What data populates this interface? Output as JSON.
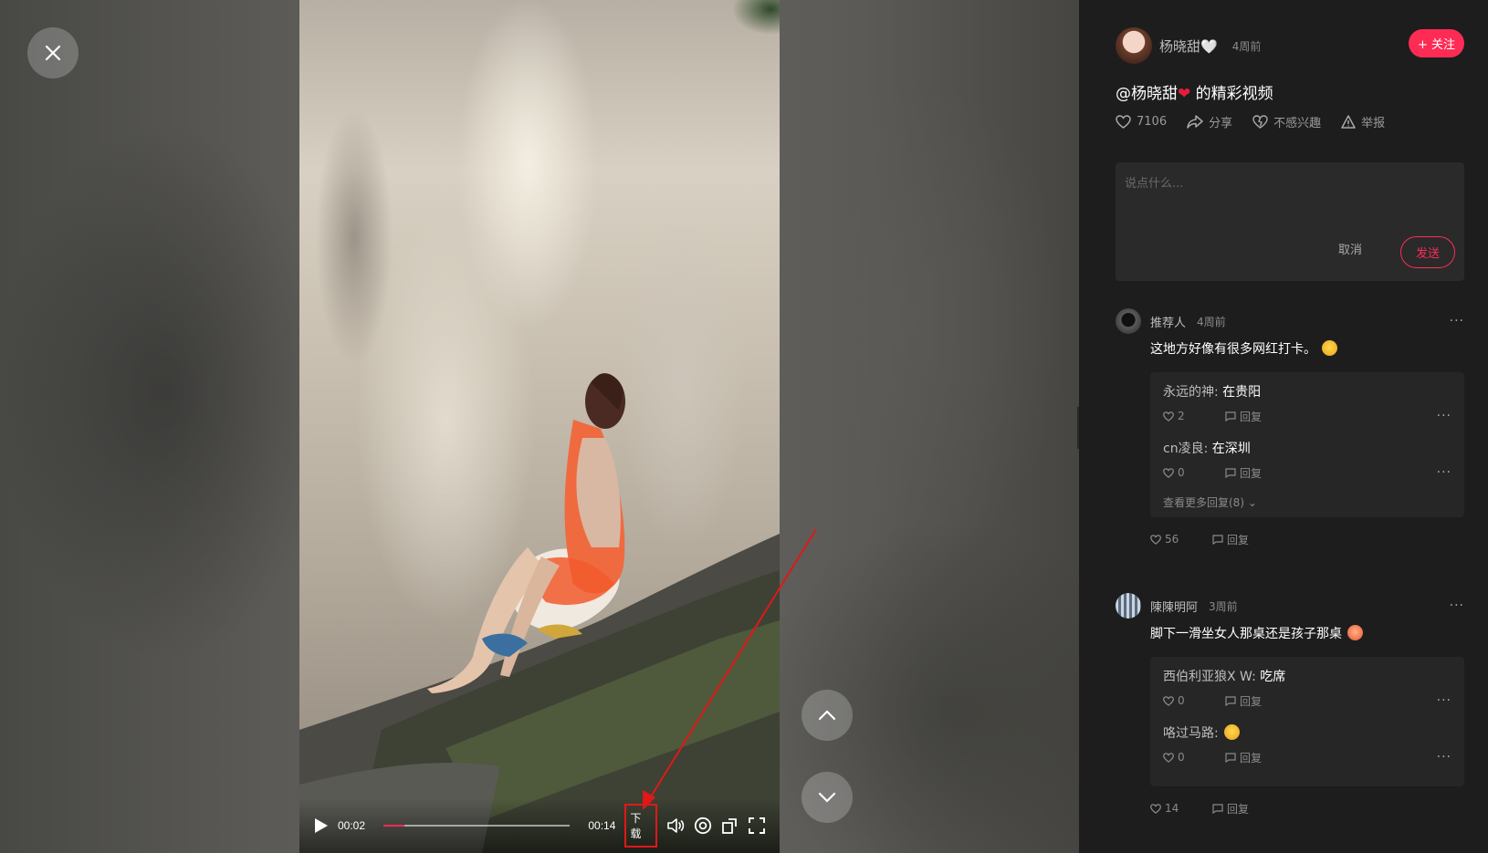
{
  "player": {
    "current_time": "00:02",
    "duration": "00:14",
    "progress": 0.11,
    "download_label": "下载"
  },
  "author": {
    "name": "杨晓甜🤍",
    "time": "4周前",
    "follow_label": "+ 关注"
  },
  "video": {
    "title_prefix": "@杨晓甜",
    "title_heart": "❤",
    "title_suffix": " 的精彩视频"
  },
  "actions": {
    "likes": "7106",
    "share": "分享",
    "not_interested": "不感兴趣",
    "report": "举报"
  },
  "comment_input": {
    "placeholder": "说点什么...",
    "cancel": "取消",
    "send": "发送"
  },
  "comments": [
    {
      "user": "推荐人",
      "time": "4周前",
      "text": "这地方好像有很多网红打卡。",
      "likes": "56",
      "reply_label": "回复",
      "replies": [
        {
          "user": "永远的神:",
          "text": "在贵阳",
          "likes": "2",
          "reply_label": "回复"
        },
        {
          "user": "cn凌良:",
          "text": "在深圳",
          "likes": "0",
          "reply_label": "回复"
        }
      ],
      "see_more": "查看更多回复(8) ⌄"
    },
    {
      "user": "陳陳明阿",
      "time": "3周前",
      "text": "脚下一滑坐女人那桌还是孩子那桌",
      "likes": "14",
      "reply_label": "回复",
      "replies": [
        {
          "user": "西伯利亚狼X W:",
          "text": "吃席",
          "likes": "0",
          "reply_label": "回复"
        },
        {
          "user": "咯过马路:",
          "text": "",
          "likes": "0",
          "reply_label": "回复"
        }
      ]
    }
  ],
  "colors": {
    "accent": "#fe2c55",
    "panel_bg": "#1d1d1d",
    "highlight_red": "#e01818"
  },
  "icons": [
    "close-icon",
    "play-icon",
    "volume-icon",
    "settings-icon",
    "rotate-icon",
    "fullscreen-icon",
    "chevron-up-icon",
    "chevron-down-icon",
    "heart-icon",
    "share-icon",
    "broken-heart-icon",
    "warning-icon",
    "reply-icon",
    "more-icon"
  ]
}
